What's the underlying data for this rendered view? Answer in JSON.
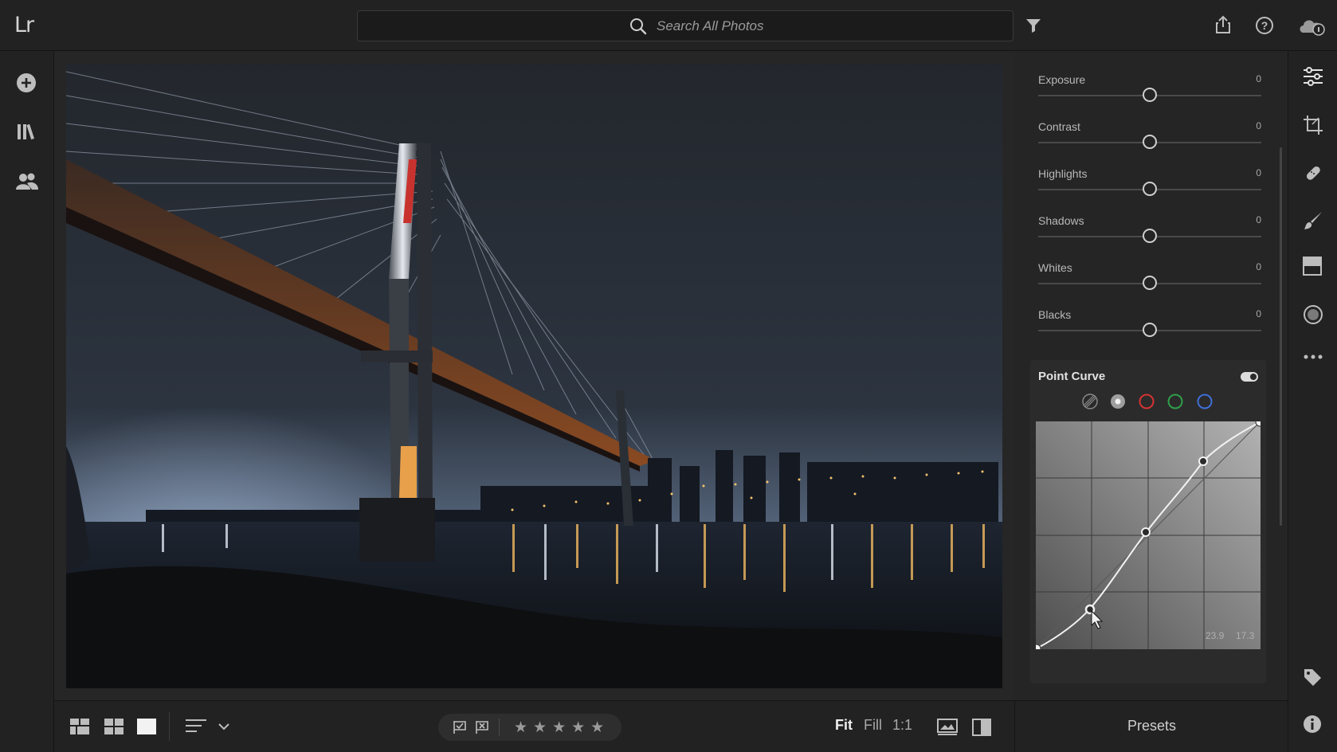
{
  "app": {
    "logo": "Lr"
  },
  "search": {
    "placeholder": "Search All Photos"
  },
  "edit": {
    "sliders": [
      {
        "label": "Exposure",
        "value": "0"
      },
      {
        "label": "Contrast",
        "value": "0"
      },
      {
        "label": "Highlights",
        "value": "0"
      },
      {
        "label": "Shadows",
        "value": "0"
      },
      {
        "label": "Whites",
        "value": "0"
      },
      {
        "label": "Blacks",
        "value": "0"
      }
    ],
    "point_curve": {
      "title": "Point Curve",
      "enabled": true,
      "channels": [
        "parametric",
        "rgb",
        "red",
        "green",
        "blue"
      ],
      "selected_channel": "rgb",
      "readout_input": "23.9",
      "readout_output": "17.3"
    }
  },
  "bottom": {
    "zoom_fit": "Fit",
    "zoom_fill": "Fill",
    "zoom_1to1": "1:1",
    "rating_stars": 5
  },
  "presets": {
    "label": "Presets"
  },
  "colors": {
    "accent_red": "#d63333",
    "accent_green": "#2fa04a",
    "accent_blue": "#3f6fd8"
  }
}
